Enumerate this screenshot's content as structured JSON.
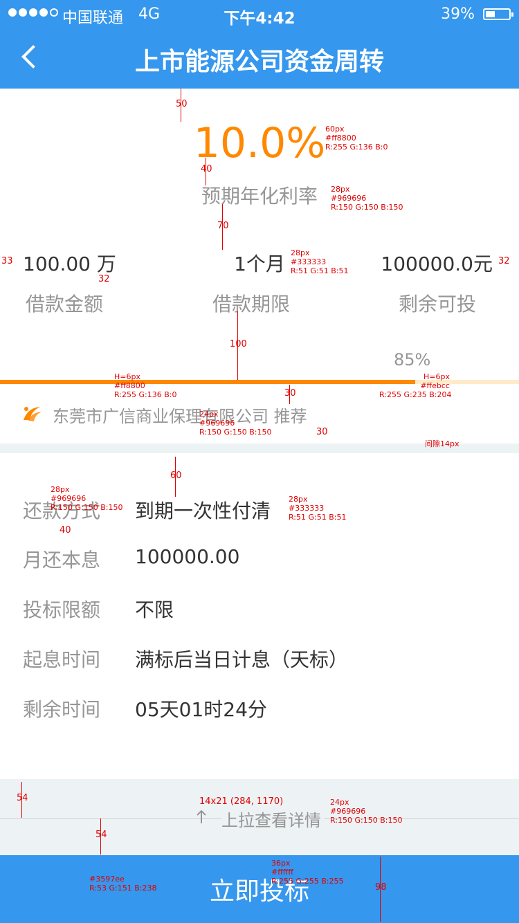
{
  "status_bar": {
    "carrier": "中国联通",
    "network": "4G",
    "time": "下午4:42",
    "battery_percent": "39%",
    "battery_level": 0.39
  },
  "nav": {
    "back_icon": "chevron-left-icon",
    "title": "上市能源公司资金周转"
  },
  "hero": {
    "rate": "10.0%",
    "rate_label": "预期年化利率"
  },
  "stats": [
    {
      "value": "100.00 万",
      "label": "借款金额"
    },
    {
      "value": "1个月",
      "label": "借款期限"
    },
    {
      "value": "100000.0元",
      "label": "剩余可投"
    }
  ],
  "progress": {
    "percent_text": "85%",
    "fraction": 0.8,
    "fill_color": "#ff8800",
    "track_color": "#ffebcc"
  },
  "recommender": {
    "icon": "guarantor-logo-icon",
    "text": "东莞市广信商业保理有限公司 推荐"
  },
  "details": [
    {
      "label": "还款方式",
      "value": "到期一次性付清"
    },
    {
      "label": "月还本息",
      "value": "100000.00"
    },
    {
      "label": "投标限额",
      "value": "不限"
    },
    {
      "label": "起息时间",
      "value": "满标后当日计息（天标）"
    },
    {
      "label": "剩余时间",
      "value": "05天01时24分"
    }
  ],
  "pull_hint": {
    "icon": "arrow-up-icon",
    "text": "上拉查看详情"
  },
  "cta": {
    "label": "立即投标",
    "color": "#3597ee"
  },
  "annotations": {
    "spacing": [
      "50",
      "40",
      "70",
      "33",
      "32",
      "32",
      "100",
      "30",
      "30",
      "60",
      "40",
      "54",
      "54",
      "98"
    ],
    "specs": [
      {
        "lines": [
          "60px",
          "#ff8800",
          "R:255   G:136   B:0"
        ]
      },
      {
        "lines": [
          "28px",
          "#969696",
          "R:150   G:150   B:150"
        ]
      },
      {
        "lines": [
          "28px",
          "#333333",
          "R:51    G:51    B:51"
        ]
      },
      {
        "lines": [
          "H=6px",
          "#ff8800",
          "R:255   G:136   B:0"
        ]
      },
      {
        "lines": [
          "H=6px",
          "#ffebcc",
          "R:255  G:235  B:204"
        ]
      },
      {
        "lines": [
          "24px",
          "#969696",
          "R:150   G:150   B:150"
        ]
      },
      {
        "lines": [
          "间隙14px"
        ]
      },
      {
        "lines": [
          "28px",
          "#969696",
          "R:150   G:150   B:150"
        ]
      },
      {
        "lines": [
          "28px",
          "#333333",
          "R:51    G:51    B:51"
        ]
      },
      {
        "lines": [
          "14x21 (284, 1170)"
        ]
      },
      {
        "lines": [
          "24px",
          "#969696",
          "R:150   G:150   B:150"
        ]
      },
      {
        "lines": [
          "#3597ee",
          "R:53  G:151   B:238"
        ]
      },
      {
        "lines": [
          "36px",
          "#ffffff",
          "R:255   G:255   B:255"
        ]
      }
    ]
  }
}
